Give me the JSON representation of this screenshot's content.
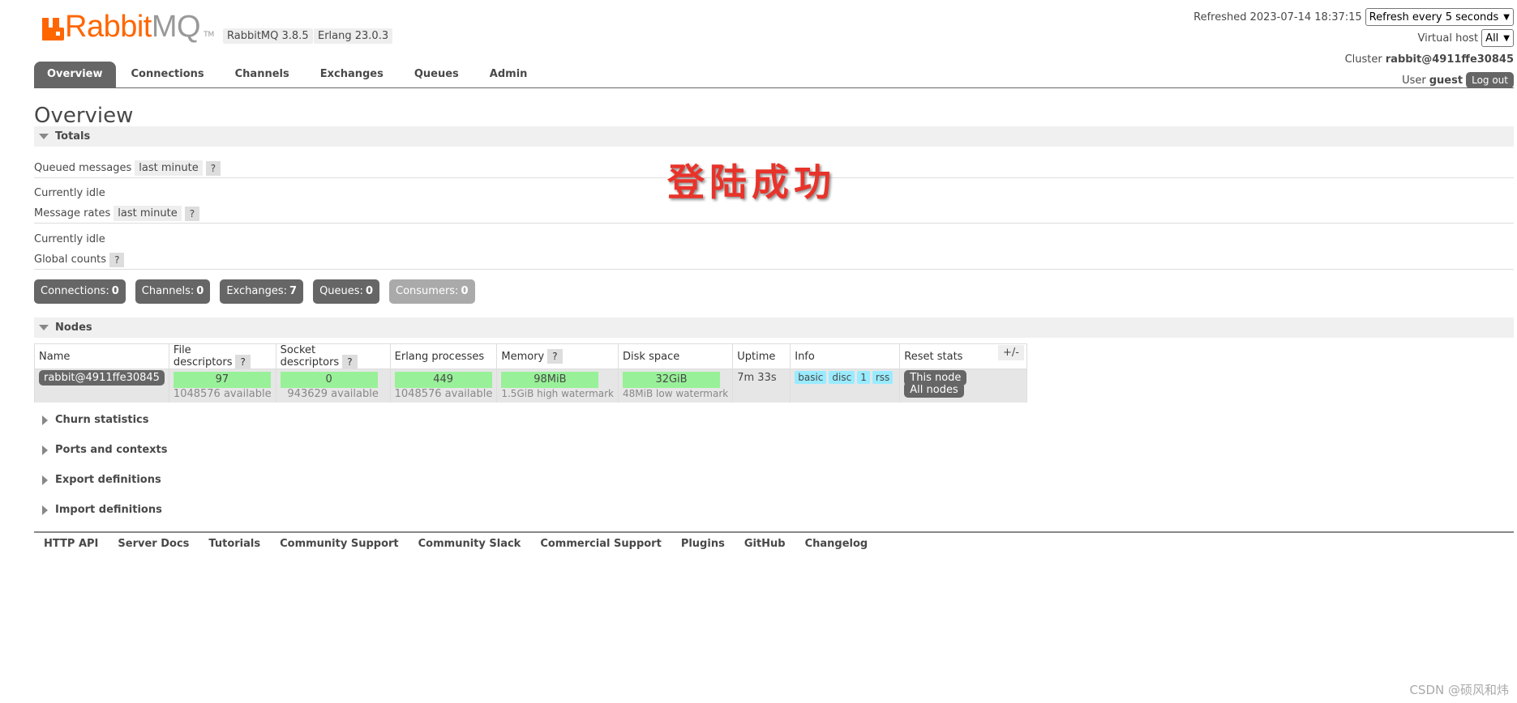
{
  "brand": {
    "rabbit": "Rabbit",
    "mq": "MQ",
    "tm": "TM",
    "version": "RabbitMQ 3.8.5",
    "erlang": "Erlang 23.0.3"
  },
  "header": {
    "refreshed_label": "Refreshed 2023-07-14 18:37:15",
    "refresh_select": "Refresh every 5 seconds",
    "vhost_label": "Virtual host",
    "vhost_select": "All",
    "cluster_label": "Cluster",
    "cluster_name": "rabbit@4911ffe30845",
    "user_label": "User",
    "user_name": "guest",
    "logout": "Log out"
  },
  "tabs": [
    "Overview",
    "Connections",
    "Channels",
    "Exchanges",
    "Queues",
    "Admin"
  ],
  "page_title": "Overview",
  "totals": {
    "title": "Totals",
    "queued_label": "Queued messages",
    "queued_range": "last minute",
    "help": "?",
    "idle1": "Currently idle",
    "rates_label": "Message rates",
    "rates_range": "last minute",
    "idle2": "Currently idle",
    "global_label": "Global counts"
  },
  "counts": [
    {
      "label": "Connections:",
      "value": "0"
    },
    {
      "label": "Channels:",
      "value": "0"
    },
    {
      "label": "Exchanges:",
      "value": "7"
    },
    {
      "label": "Queues:",
      "value": "0"
    },
    {
      "label": "Consumers:",
      "value": "0"
    }
  ],
  "nodes": {
    "title": "Nodes",
    "headers": [
      "Name",
      "File descriptors",
      "Socket descriptors",
      "Erlang processes",
      "Memory",
      "Disk space",
      "Uptime",
      "Info",
      "Reset stats"
    ],
    "plus_minus": "+/-",
    "row": {
      "name": "rabbit@4911ffe30845",
      "fd": "97",
      "fd_sub": "1048576 available",
      "sock": "0",
      "sock_sub": "943629 available",
      "erl": "449",
      "erl_sub": "1048576 available",
      "mem": "98MiB",
      "mem_sub": "1.5GiB high watermark",
      "disk": "32GiB",
      "disk_sub": "48MiB low watermark",
      "uptime": "7m 33s",
      "info": [
        "basic",
        "disc",
        "1",
        "rss"
      ],
      "reset_this": "This node",
      "reset_all": "All nodes"
    }
  },
  "sections": [
    "Churn statistics",
    "Ports and contexts",
    "Export definitions",
    "Import definitions"
  ],
  "footer": [
    "HTTP API",
    "Server Docs",
    "Tutorials",
    "Community Support",
    "Community Slack",
    "Commercial Support",
    "Plugins",
    "GitHub",
    "Changelog"
  ],
  "overlay_text": "登陆成功",
  "watermark": "CSDN @硕风和炜",
  "colors": {
    "brand_orange": "#ff6600",
    "dark_button": "#666666",
    "green_bar": "#98f198",
    "info_tag": "#99ebff",
    "stamp_red": "#e8332a"
  }
}
